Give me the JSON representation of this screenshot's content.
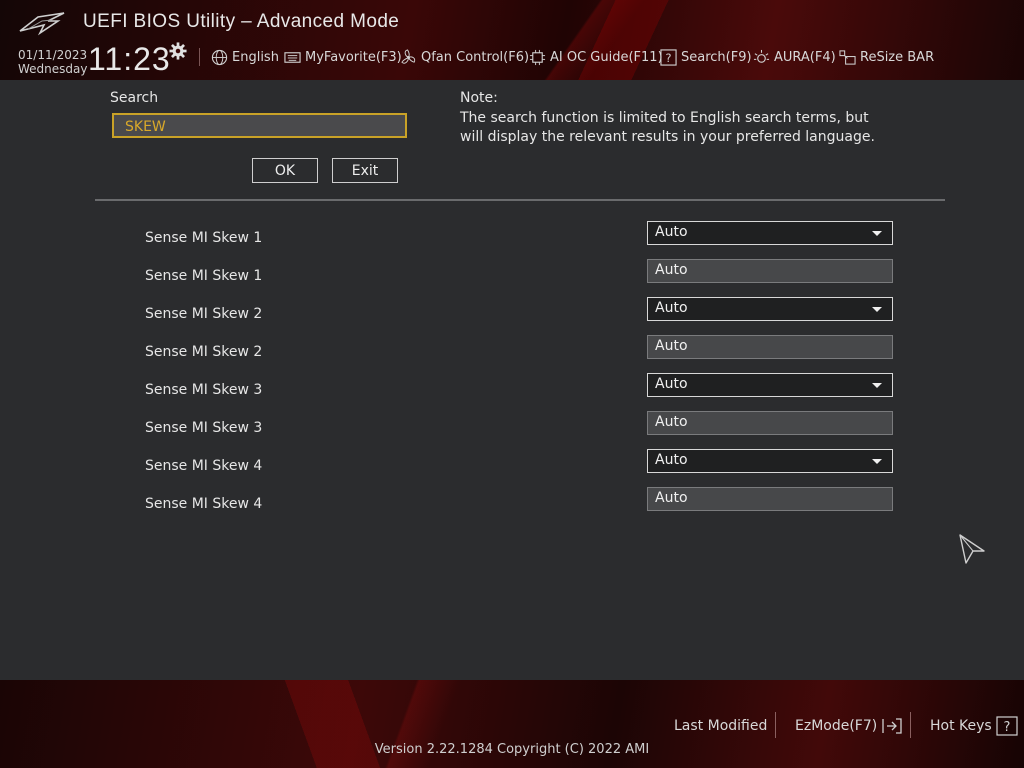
{
  "header": {
    "title": "UEFI BIOS Utility – Advanced Mode",
    "date": "01/11/2023",
    "weekday": "Wednesday",
    "time": "11:23",
    "menu": {
      "language": "English",
      "myfavorite": "MyFavorite(F3)",
      "qfan": "Qfan Control(F6)",
      "aioc": "AI OC Guide(F11)",
      "search": "Search(F9)",
      "aura": "AURA(F4)",
      "resizebar": "ReSize BAR"
    }
  },
  "search": {
    "label": "Search",
    "value": "SKEW",
    "ok_label": "OK",
    "exit_label": "Exit"
  },
  "note": {
    "title": "Note:",
    "text": "The search function is limited to English search terms, but will display the relevant results in your preferred language."
  },
  "results": [
    {
      "label": "Sense MI Skew 1",
      "value": "Auto",
      "kind": "dropdown"
    },
    {
      "label": "Sense MI Skew 1",
      "value": "Auto",
      "kind": "readonly"
    },
    {
      "label": "Sense MI Skew 2",
      "value": "Auto",
      "kind": "dropdown"
    },
    {
      "label": "Sense MI Skew 2",
      "value": "Auto",
      "kind": "readonly"
    },
    {
      "label": "Sense MI Skew 3",
      "value": "Auto",
      "kind": "dropdown"
    },
    {
      "label": "Sense MI Skew 3",
      "value": "Auto",
      "kind": "readonly"
    },
    {
      "label": "Sense MI Skew 4",
      "value": "Auto",
      "kind": "dropdown"
    },
    {
      "label": "Sense MI Skew 4",
      "value": "Auto",
      "kind": "readonly"
    }
  ],
  "footer": {
    "last_modified": "Last Modified",
    "ezmode": "EzMode(F7)",
    "hotkeys": "Hot Keys",
    "version": "Version 2.22.1284 Copyright (C) 2022 AMI"
  },
  "colors": {
    "accent_gold": "#c9a227",
    "header_red": "#3a0707",
    "panel_bg": "#2b2c2e"
  },
  "icons": [
    "rog-logo-icon",
    "gear-icon",
    "globe-icon",
    "keyboard-icon",
    "fan-icon",
    "ai-chip-icon",
    "search-icon",
    "aura-icon",
    "resize-bar-icon",
    "exit-arrow-icon",
    "help-icon",
    "mouse-cursor-icon"
  ]
}
